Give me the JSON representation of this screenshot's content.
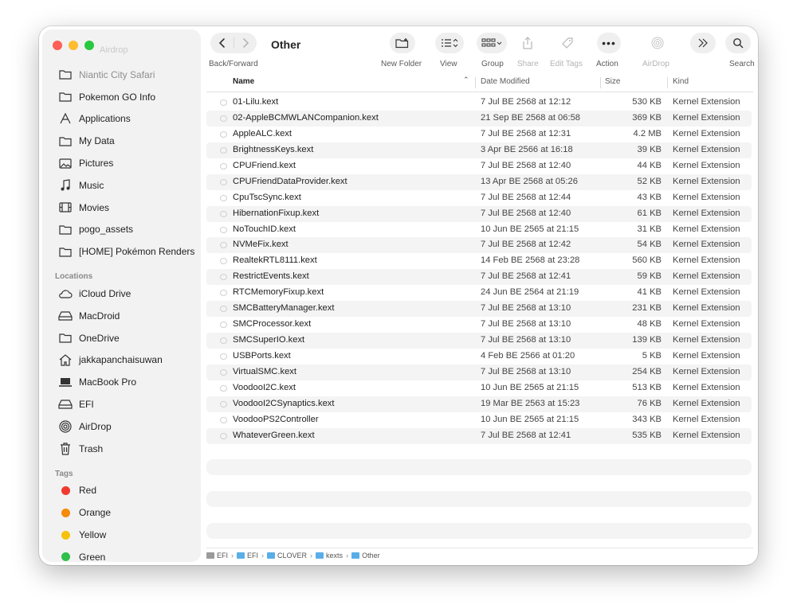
{
  "window": {
    "title": "Other",
    "ghost_label": "Airdrop"
  },
  "toolbar": {
    "back_forward_label": "Back/Forward",
    "new_folder_label": "New Folder",
    "view_label": "View",
    "group_label": "Group",
    "share_label": "Share",
    "edit_tags_label": "Edit Tags",
    "action_label": "Action",
    "airdrop_label": "AirDrop",
    "search_label": "Search"
  },
  "sidebar": {
    "favorites": [
      {
        "label": "Niantic City Safari",
        "icon": "folder-icon"
      },
      {
        "label": "Pokemon GO Info",
        "icon": "folder-icon"
      },
      {
        "label": "Applications",
        "icon": "applications-icon"
      },
      {
        "label": "My Data",
        "icon": "folder-icon"
      },
      {
        "label": "Pictures",
        "icon": "pictures-icon"
      },
      {
        "label": "Music",
        "icon": "music-icon"
      },
      {
        "label": "Movies",
        "icon": "movies-icon"
      },
      {
        "label": "pogo_assets",
        "icon": "folder-icon"
      },
      {
        "label": "[HOME] Pokémon Renders",
        "icon": "folder-icon"
      }
    ],
    "locations_header": "Locations",
    "locations": [
      {
        "label": "iCloud Drive",
        "icon": "cloud-icon"
      },
      {
        "label": "MacDroid",
        "icon": "drive-icon"
      },
      {
        "label": "OneDrive",
        "icon": "folder-icon"
      },
      {
        "label": "jakkapanchaisuwan",
        "icon": "home-icon"
      },
      {
        "label": "MacBook Pro",
        "icon": "laptop-icon"
      },
      {
        "label": "EFI",
        "icon": "drive-icon"
      },
      {
        "label": "AirDrop",
        "icon": "airdrop-icon"
      },
      {
        "label": "Trash",
        "icon": "trash-icon"
      }
    ],
    "tags_header": "Tags",
    "tags": [
      {
        "label": "Red",
        "color": "#f03a2f"
      },
      {
        "label": "Orange",
        "color": "#f58a0b"
      },
      {
        "label": "Yellow",
        "color": "#f6c10a"
      },
      {
        "label": "Green",
        "color": "#2fbf4a"
      }
    ]
  },
  "columns": {
    "name": "Name",
    "date_modified": "Date Modified",
    "size": "Size",
    "kind": "Kind"
  },
  "files": [
    {
      "name": "01-Lilu.kext",
      "date": "7 Jul BE 2568 at 12:12",
      "size": "530 KB",
      "kind": "Kernel Extension"
    },
    {
      "name": "02-AppleBCMWLANCompanion.kext",
      "date": "21 Sep BE 2568 at 06:58",
      "size": "369 KB",
      "kind": "Kernel Extension"
    },
    {
      "name": "AppleALC.kext",
      "date": "7 Jul BE 2568 at 12:31",
      "size": "4.2 MB",
      "kind": "Kernel Extension"
    },
    {
      "name": "BrightnessKeys.kext",
      "date": "3 Apr BE 2566 at 16:18",
      "size": "39 KB",
      "kind": "Kernel Extension"
    },
    {
      "name": "CPUFriend.kext",
      "date": "7 Jul BE 2568 at 12:40",
      "size": "44 KB",
      "kind": "Kernel Extension"
    },
    {
      "name": "CPUFriendDataProvider.kext",
      "date": "13 Apr BE 2568 at 05:26",
      "size": "52 KB",
      "kind": "Kernel Extension"
    },
    {
      "name": "CpuTscSync.kext",
      "date": "7 Jul BE 2568 at 12:44",
      "size": "43 KB",
      "kind": "Kernel Extension"
    },
    {
      "name": "HibernationFixup.kext",
      "date": "7 Jul BE 2568 at 12:40",
      "size": "61 KB",
      "kind": "Kernel Extension"
    },
    {
      "name": "NoTouchID.kext",
      "date": "10 Jun BE 2565 at 21:15",
      "size": "31 KB",
      "kind": "Kernel Extension"
    },
    {
      "name": "NVMeFix.kext",
      "date": "7 Jul BE 2568 at 12:42",
      "size": "54 KB",
      "kind": "Kernel Extension"
    },
    {
      "name": "RealtekRTL8111.kext",
      "date": "14 Feb BE 2568 at 23:28",
      "size": "560 KB",
      "kind": "Kernel Extension"
    },
    {
      "name": "RestrictEvents.kext",
      "date": "7 Jul BE 2568 at 12:41",
      "size": "59 KB",
      "kind": "Kernel Extension"
    },
    {
      "name": "RTCMemoryFixup.kext",
      "date": "24 Jun BE 2564 at 21:19",
      "size": "41 KB",
      "kind": "Kernel Extension"
    },
    {
      "name": "SMCBatteryManager.kext",
      "date": "7 Jul BE 2568 at 13:10",
      "size": "231 KB",
      "kind": "Kernel Extension"
    },
    {
      "name": "SMCProcessor.kext",
      "date": "7 Jul BE 2568 at 13:10",
      "size": "48 KB",
      "kind": "Kernel Extension"
    },
    {
      "name": "SMCSuperIO.kext",
      "date": "7 Jul BE 2568 at 13:10",
      "size": "139 KB",
      "kind": "Kernel Extension"
    },
    {
      "name": "USBPorts.kext",
      "date": "4 Feb BE 2566 at 01:20",
      "size": "5 KB",
      "kind": "Kernel Extension"
    },
    {
      "name": "VirtualSMC.kext",
      "date": "7 Jul BE 2568 at 13:10",
      "size": "254 KB",
      "kind": "Kernel Extension"
    },
    {
      "name": "VoodooI2C.kext",
      "date": "10 Jun BE 2565 at 21:15",
      "size": "513 KB",
      "kind": "Kernel Extension"
    },
    {
      "name": "VoodooI2CSynaptics.kext",
      "date": "19 Mar BE 2563 at 15:23",
      "size": "76 KB",
      "kind": "Kernel Extension"
    },
    {
      "name": "VoodooPS2Controller",
      "date": "10 Jun BE 2565 at 21:15",
      "size": "343 KB",
      "kind": "Kernel Extension"
    },
    {
      "name": "WhateverGreen.kext",
      "date": "7 Jul BE 2568 at 12:41",
      "size": "535 KB",
      "kind": "Kernel Extension"
    }
  ],
  "pathbar": [
    {
      "label": "EFI",
      "icon": "disk-icon"
    },
    {
      "label": "EFI",
      "icon": "folder-icon"
    },
    {
      "label": "CLOVER",
      "icon": "folder-icon"
    },
    {
      "label": "kexts",
      "icon": "folder-icon"
    },
    {
      "label": "Other",
      "icon": "folder-icon"
    }
  ]
}
